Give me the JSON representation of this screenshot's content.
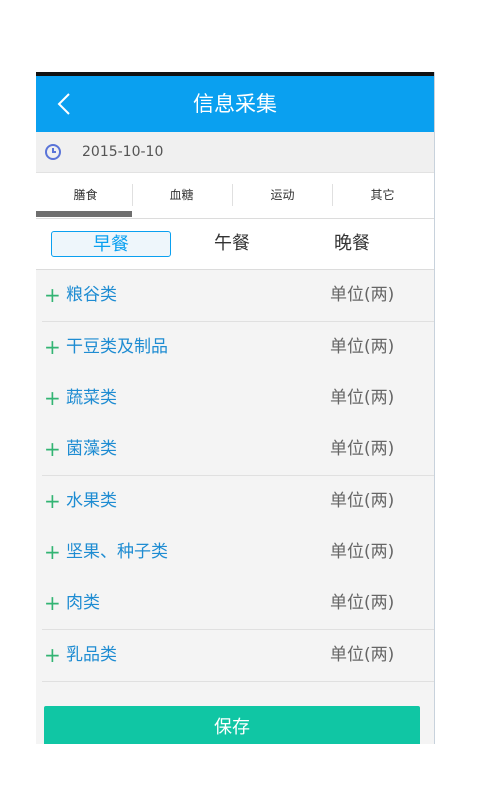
{
  "header": {
    "title": "信息采集"
  },
  "date": {
    "value": "2015-10-10"
  },
  "tabs": [
    {
      "label": "膳食"
    },
    {
      "label": "血糖"
    },
    {
      "label": "运动"
    },
    {
      "label": "其它"
    }
  ],
  "meals": [
    {
      "label": "早餐"
    },
    {
      "label": "午餐"
    },
    {
      "label": "晚餐"
    }
  ],
  "food_groups": [
    {
      "label": "粮谷类",
      "unit": "单位(两)"
    },
    {
      "label": "干豆类及制品",
      "unit": "单位(两)"
    },
    {
      "label": "蔬菜类",
      "unit": "单位(两)"
    },
    {
      "label": "菌藻类",
      "unit": "单位(两)"
    },
    {
      "label": "水果类",
      "unit": "单位(两)"
    },
    {
      "label": "坚果、种子类",
      "unit": "单位(两)"
    },
    {
      "label": "肉类",
      "unit": "单位(两)"
    },
    {
      "label": "乳品类",
      "unit": "单位(两)"
    }
  ],
  "footer": {
    "save_label": "保存"
  },
  "colors": {
    "appbar": "#0aa0f0",
    "save": "#10c6a4",
    "plus": "#32b473",
    "label": "#1e8cd2"
  },
  "icons": {
    "back": "chevron-left-icon",
    "date": "clock-icon",
    "expand": "plus-icon"
  }
}
